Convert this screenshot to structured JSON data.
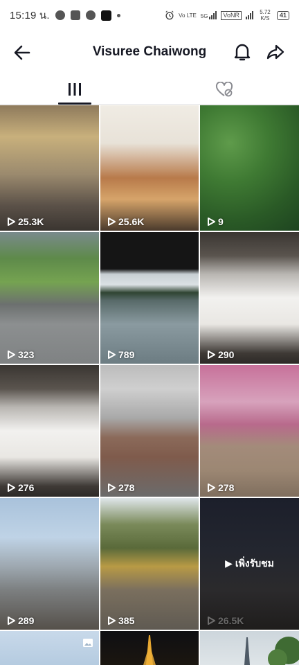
{
  "status_bar": {
    "time": "15:19 น.",
    "network_labels": [
      "Vo LTE",
      "5G"
    ],
    "vonr": "VoNR",
    "speed": "5.72 K/S",
    "battery": "41"
  },
  "header": {
    "title": "Visuree Chaiwong",
    "back_icon": "arrow-left-icon",
    "bell_icon": "bell-icon",
    "share_icon": "share-arrow-icon"
  },
  "tabs": [
    {
      "icon": "grid-bars-icon",
      "active": true
    },
    {
      "icon": "heart-hidden-icon",
      "active": false
    }
  ],
  "videos": [
    {
      "views": "25.3K",
      "scene": "hall"
    },
    {
      "views": "25.6K",
      "scene": "market"
    },
    {
      "views": "9",
      "scene": "leaves"
    },
    {
      "views": "323",
      "scene": "park"
    },
    {
      "views": "789",
      "scene": "river"
    },
    {
      "views": "290",
      "scene": "dessert"
    },
    {
      "views": "276",
      "scene": "dessert"
    },
    {
      "views": "278",
      "scene": "locks"
    },
    {
      "views": "278",
      "scene": "blossom"
    },
    {
      "views": "289",
      "scene": "paris"
    },
    {
      "views": "385",
      "scene": "temple"
    },
    {
      "views": "26.5K",
      "scene": "night",
      "overlay": "เพิ่งรับชม"
    },
    {
      "views": "",
      "scene": "sky",
      "photo": true
    },
    {
      "views": "",
      "scene": "tower-gold"
    },
    {
      "views": "",
      "scene": "tower-day"
    }
  ],
  "colors": {
    "text": "#161823",
    "divider": "#e3e3e4",
    "overlay_text": "#ffffff"
  }
}
